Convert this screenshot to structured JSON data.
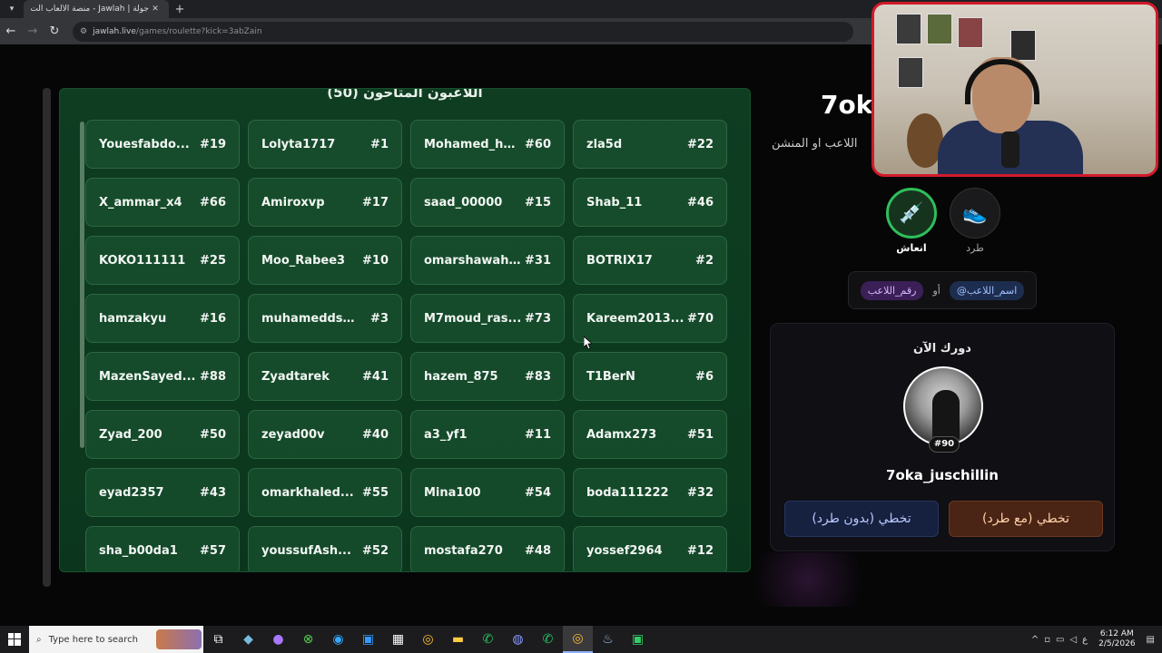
{
  "browser": {
    "tab_title": "جولة | Jawlah - منصة الألعاب الت...",
    "url_host": "jawlah.live",
    "url_path": "/games/roulette?kick=3abZain"
  },
  "panel": {
    "title": "اللاعبون المتاحون (50)",
    "players": [
      {
        "name": "Youesfabdo...",
        "num": "#19"
      },
      {
        "name": "Lolyta1717",
        "num": "#1"
      },
      {
        "name": "Mohamed_ho...",
        "num": "#60"
      },
      {
        "name": "zla5d",
        "num": "#22"
      },
      {
        "name": "X_ammar_x4",
        "num": "#66"
      },
      {
        "name": "Amiroxvp",
        "num": "#17"
      },
      {
        "name": "saad_00000",
        "num": "#15"
      },
      {
        "name": "Shab_11",
        "num": "#46"
      },
      {
        "name": "KOKO111111",
        "num": "#25"
      },
      {
        "name": "Moo_Rabee3",
        "num": "#10"
      },
      {
        "name": "omarshawah...",
        "num": "#31"
      },
      {
        "name": "BOTRIX17",
        "num": "#2"
      },
      {
        "name": "hamzakyu",
        "num": "#16"
      },
      {
        "name": "muhameddsa...",
        "num": "#3"
      },
      {
        "name": "M7moud_ras...",
        "num": "#73"
      },
      {
        "name": "Kareem2013...",
        "num": "#70"
      },
      {
        "name": "MazenSayed...",
        "num": "#88"
      },
      {
        "name": "Zyadtarek",
        "num": "#41"
      },
      {
        "name": "hazem_875",
        "num": "#83"
      },
      {
        "name": "T1BerN",
        "num": "#6"
      },
      {
        "name": "Zyad_200",
        "num": "#50"
      },
      {
        "name": "zeyad00v",
        "num": "#40"
      },
      {
        "name": "a3_yf1",
        "num": "#11"
      },
      {
        "name": "Adamx273",
        "num": "#51"
      },
      {
        "name": "eyad2357",
        "num": "#43"
      },
      {
        "name": "omarkhaled...",
        "num": "#55"
      },
      {
        "name": "Mina100",
        "num": "#54"
      },
      {
        "name": "boda111222",
        "num": "#32"
      },
      {
        "name": "sha_b00da1",
        "num": "#57"
      },
      {
        "name": "youssufAsh...",
        "num": "#52"
      },
      {
        "name": "mostafa270",
        "num": "#48"
      },
      {
        "name": "yossef2964",
        "num": "#12"
      }
    ]
  },
  "side": {
    "big_name": "7oka",
    "hint": "اللاعب او المنشن",
    "revive_label": "انعاش",
    "kick_label": "طرد",
    "tag_player_number": "رقم_اللاعب",
    "tag_or": "أو",
    "tag_player_name": "@اسم_اللاعب",
    "turn_title": "دورك الآن",
    "turn_badge": "#90",
    "turn_name": "7oka_juschillin",
    "btn_no_kick": "تخطي (بدون طرد)",
    "btn_kick": "تخطي (مع طرد)"
  },
  "taskbar": {
    "search_placeholder": "Type here to search",
    "lang": "ع",
    "time": "6:12 AM",
    "date": "2/5/2026"
  }
}
